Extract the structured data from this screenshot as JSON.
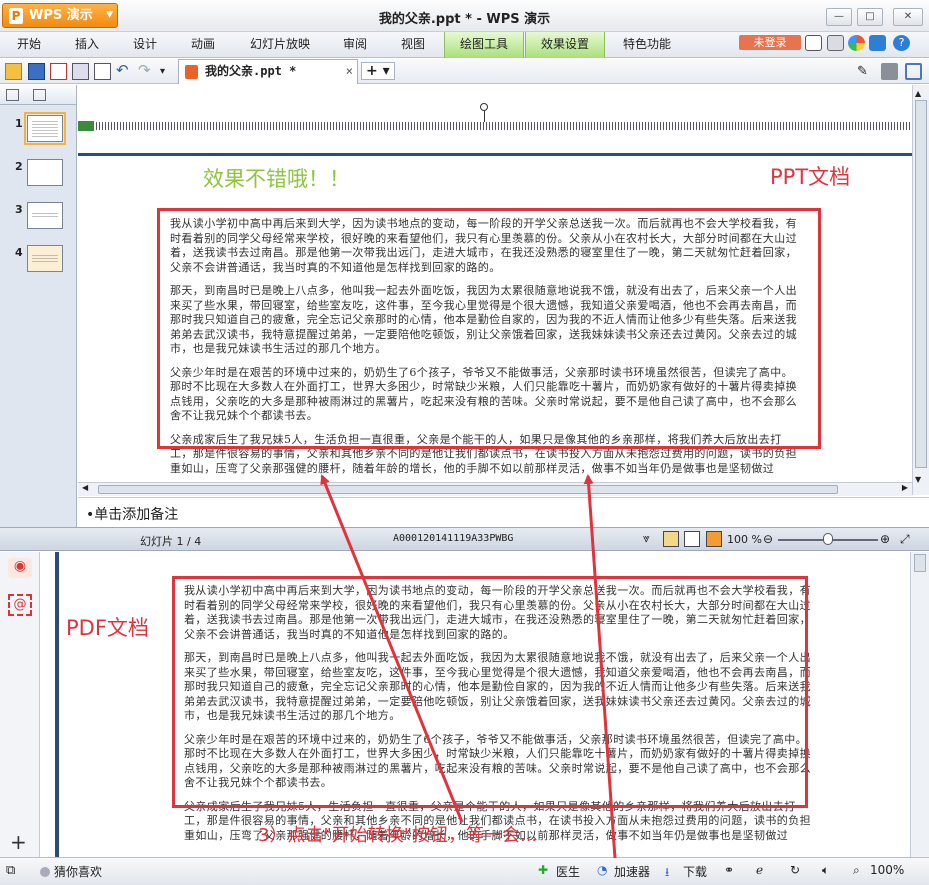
{
  "app": {
    "logo": "WPS 演示",
    "title": "我的父亲.ppt * - WPS 演示"
  },
  "menu": [
    "开始",
    "插入",
    "设计",
    "动画",
    "幻灯片放映",
    "审阅",
    "视图",
    "绘图工具",
    "效果设置",
    "特色功能"
  ],
  "login_label": "未登录",
  "doc_tab": {
    "name": "我的父亲.ppt *",
    "close": "×"
  },
  "new_tab": "+ ▾",
  "slides": {
    "numbers": [
      "1",
      "2",
      "3",
      "4"
    ]
  },
  "notes_placeholder": "•单击添加备注",
  "status": {
    "slide_counter": "幻灯片 1 / 4",
    "doc_id": "A000120141119A33PWBG",
    "zoom": "100 %"
  },
  "bottom": {
    "guess": "猜你喜欢",
    "doctor": "医生",
    "accelerator": "加速器",
    "download": "下载",
    "zoom": "100%"
  },
  "annotations": {
    "good_effect": "效果不错哦！！",
    "ppt_doc": "PPT文档",
    "pdf_doc": "PDF文档",
    "step3": "3）点击\"开始转换\"按钮，等一会..."
  },
  "essay": {
    "p1": "我从读小学初中高中再后来到大学，因为读书地点的变动，每一阶段的开学父亲总送我一次。而后就再也不会大学校看我，有时看着别的同学父母经常来学校，很好晚的来看望他们，我只有心里羡慕的份。父亲从小在农村长大，大部分时间都在大山过着，送我读书去过南昌。那是他第一次带我出远门，走进大城市，在我还没熟悉的寝室里住了一晚，第二天就匆忙赶着回家，父亲不会讲普通话，我当时真的不知道他是怎样找到回家的路的。",
    "p2": "那天，到南昌时已是晚上八点多，他叫我一起去外面吃饭，我因为太累很随意地说我不饿，就没有出去了，后来父亲一个人出来买了些水果，带回寝室，给些室友吃，这件事，至今我心里觉得是个很大遗憾，我知道父亲爱喝酒，他也不会再去南昌，而那时我只知道自己的疲惫，完全忘记父亲那时的心情，他本是勤俭自家的，因为我的不近人情而让他多少有些失落。后来送我弟弟去武汉读书，我特意提醒过弟弟，一定要陪他吃顿饭，别让父亲饿着回家，送我妹妹读书父亲还去过黄冈。父亲去过的城市，也是我兄妹读书生活过的那几个地方。",
    "p3": "父亲少年时是在艰苦的环境中过来的，奶奶生了6个孩子，爷爷又不能做事活，父亲那时读书环境虽然很苦，但读完了高中。那时不比现在大多数人在外面打工，世界大多困少，时常缺少米粮，人们只能靠吃十薯片，而奶奶家有做好的十薯片得卖掉换点钱用，父亲吃的大多是那种被雨淋过的黑薯片，吃起来没有粮的苦味。父亲时常说起，要不是他自己读了高中，也不会那么舍不让我兄妹个个都读书去。",
    "p4": "父亲成家后生了我兄妹5人，生活负担一直很重，父亲是个能干的人，如果只是像其他的乡亲那样，将我们养大后放出去打工，那是件很容易的事情，父亲和其他乡亲不同的是他让我们都读点书，在读书投入方面从未抱怨过费用的问题，读书的负担重如山，压弯了父亲那强健的腰杆，随着年龄的增长，他的手脚不如以前那样灵活，做事不如当年仍是做事也是坚韧做过"
  }
}
